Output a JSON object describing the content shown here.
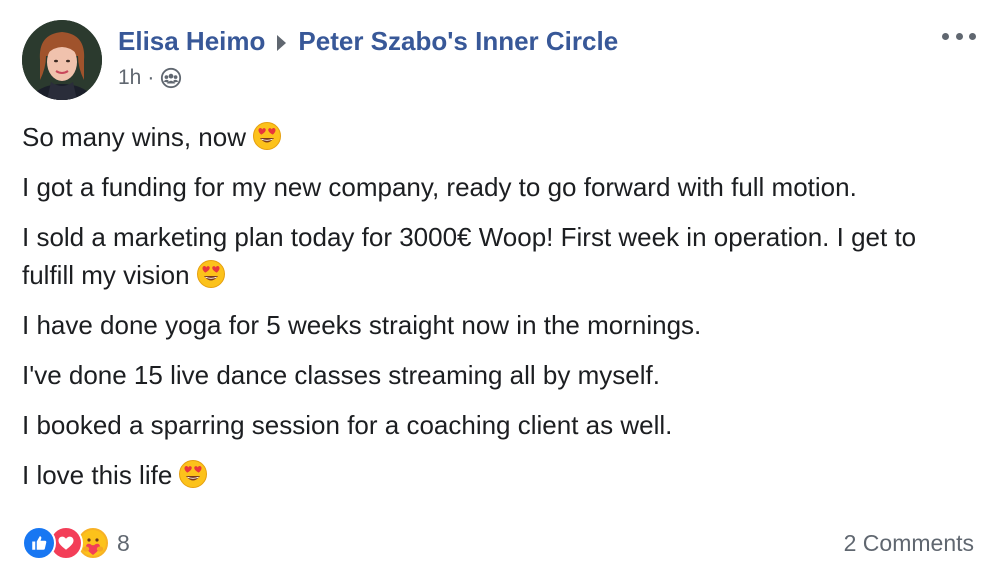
{
  "post": {
    "author": "Elisa Heimo",
    "group": "Peter Szabo's Inner Circle",
    "time": "1h",
    "time_separator": "·",
    "audience_icon": "group-icon",
    "more_icon": "more-options-icon"
  },
  "body": {
    "paragraphs": [
      "So many wins, now",
      "I got a funding for my new company, ready to go forward with full motion.",
      "I sold a marketing plan today for 3000€ Woop! First week in operation. I get to fulfill my vision",
      "I have done yoga for 5 weeks straight now in the mornings.",
      "I've done 15 live dance classes streaming all by myself.",
      "I booked a sparring session for a coaching client as well.",
      "I love this life"
    ],
    "emoji": "heart-eyes-emoji"
  },
  "footer": {
    "reactions": [
      "like-icon",
      "love-icon",
      "care-icon"
    ],
    "reaction_count": "8",
    "comments": "2 Comments"
  },
  "colors": {
    "link": "#385898",
    "text": "#1c1e21",
    "secondary": "#606770",
    "like": "#1877f2",
    "love": "#f33e58",
    "care": "#f7b125"
  }
}
